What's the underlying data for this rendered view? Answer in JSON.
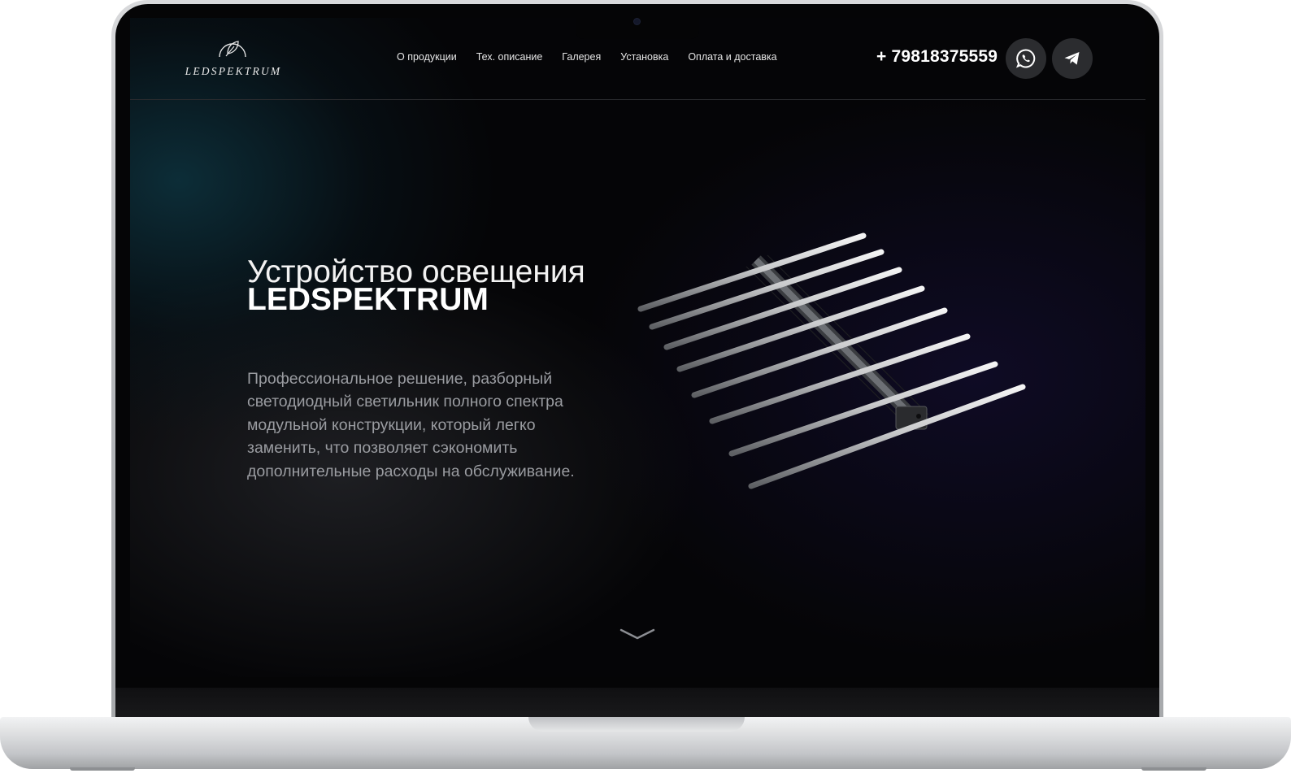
{
  "brand": {
    "name": "LEDSPEKTRUM"
  },
  "nav": {
    "items": [
      "О продукции",
      "Тех. описание",
      "Галерея",
      "Установка",
      "Оплата и доставка"
    ]
  },
  "contact": {
    "phone": "+ 79818375559",
    "whatsapp_icon": "whatsapp-icon",
    "telegram_icon": "telegram-icon"
  },
  "hero": {
    "title_line1": "Устройство освещения",
    "title_line2": "LEDSPEKTRUM",
    "description": "Профессиональное решение, разборный светодиодный светильник полного спектра модульной конструкции, который легко заменить, что позволяет сэкономить дополнительные расходы на обслуживание.",
    "product_image": "led-grow-light-bars",
    "scroll_icon": "chevron-down-icon"
  },
  "colors": {
    "background": "#050507",
    "accent_teal": "#0e3440",
    "social_button_bg": "#2b2c2f",
    "description_text": "#9a9ca1"
  }
}
